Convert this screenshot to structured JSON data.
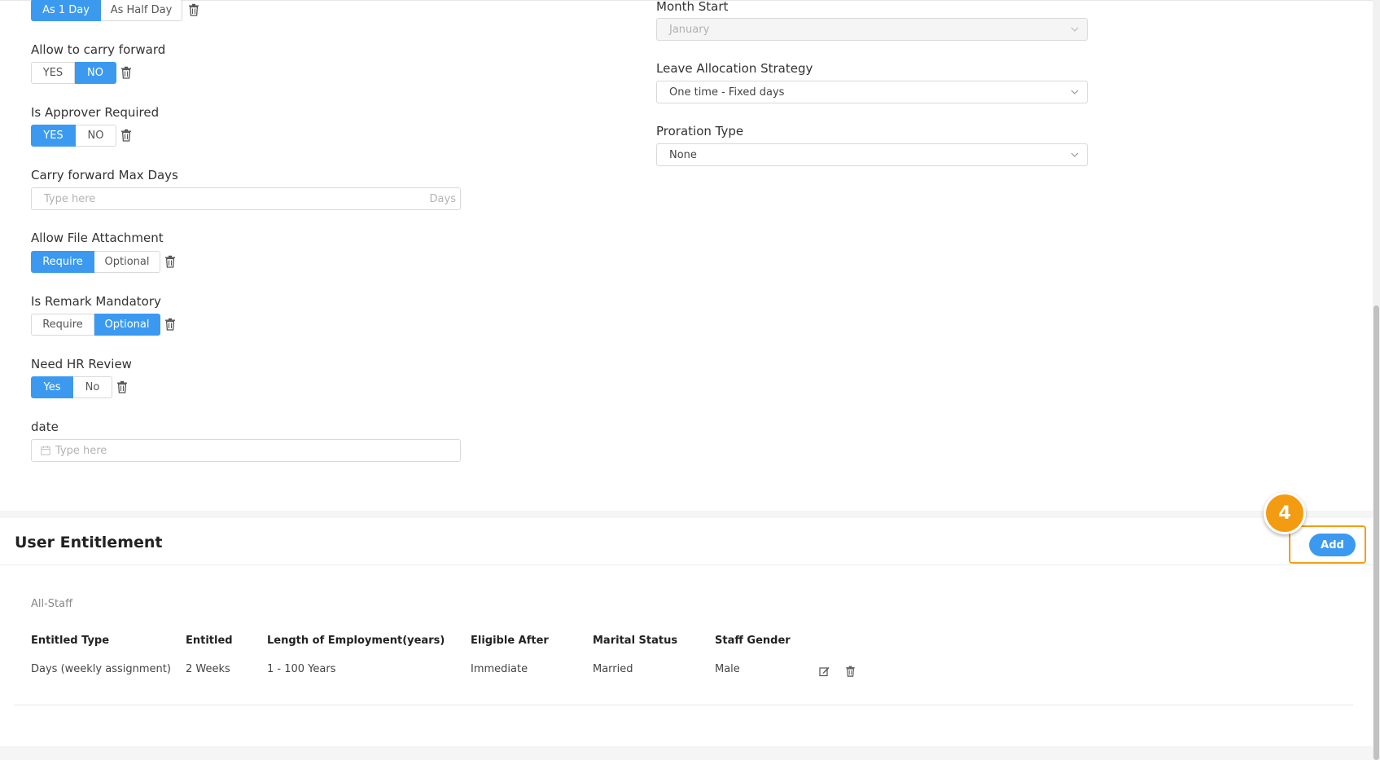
{
  "form": {
    "day_type": {
      "options": [
        "As 1 Day",
        "As Half Day"
      ],
      "selected": 0
    },
    "carry_forward": {
      "label": "Allow to carry forward",
      "options": [
        "YES",
        "NO"
      ],
      "selected": 1
    },
    "approver_required": {
      "label": "Is Approver Required",
      "options": [
        "YES",
        "NO"
      ],
      "selected": 0
    },
    "carry_forward_max": {
      "label": "Carry forward Max Days",
      "placeholder": "Type here",
      "suffix": "Days"
    },
    "file_attachment": {
      "label": "Allow File Attachment",
      "options": [
        "Require",
        "Optional"
      ],
      "selected": 0
    },
    "remark_mandatory": {
      "label": "Is Remark Mandatory",
      "options": [
        "Require",
        "Optional"
      ],
      "selected": 1
    },
    "hr_review": {
      "label": "Need HR Review",
      "options": [
        "Yes",
        "No"
      ],
      "selected": 0
    },
    "date": {
      "label": "date",
      "placeholder": "Type here"
    },
    "month_start": {
      "label": "Month Start",
      "value": "January"
    },
    "allocation_strategy": {
      "label": "Leave Allocation Strategy",
      "value": "One time - Fixed days"
    },
    "proration_type": {
      "label": "Proration Type",
      "value": "None"
    }
  },
  "entitlement": {
    "title": "User Entitlement",
    "add_label": "Add",
    "step_badge": "4",
    "group": "All-Staff",
    "columns": [
      "Entitled Type",
      "Entitled",
      "Length of Employment(years)",
      "Eligible After",
      "Marital Status",
      "Staff Gender"
    ],
    "rows": [
      [
        "Days (weekly assignment)",
        "2 Weeks",
        "1 - 100 Years",
        "Immediate",
        "Married",
        "Male"
      ]
    ]
  },
  "colors": {
    "accent": "#3b9af0",
    "highlight": "#f39c12"
  },
  "icons": {
    "delete": "trash-icon",
    "edit": "edit-icon",
    "dropdown": "chevron-down-icon",
    "calendar": "calendar-icon"
  }
}
